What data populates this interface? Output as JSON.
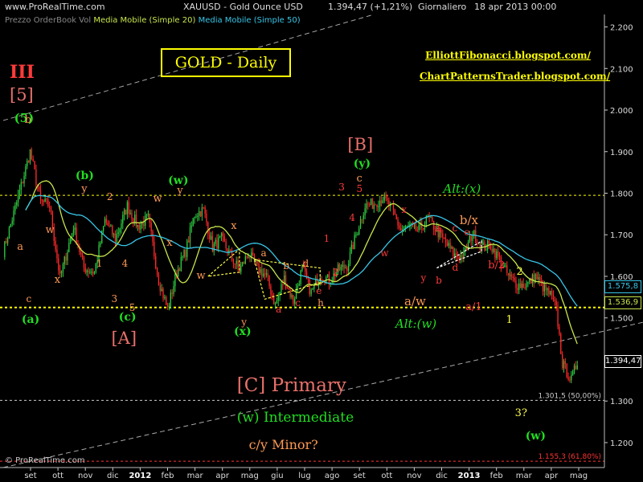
{
  "header": {
    "site": "www.ProRealTime.com",
    "instrument": "XAUUSD - Gold Ounce USD",
    "last": "1.394,47 (+1,21%)",
    "period": "Giornaliero",
    "date": "18 apr 2013 00:00"
  },
  "subheader": {
    "prefix": "Prezzo OrderBook Vol",
    "ma20": "Media Mobile (Simple 20)",
    "ma50": "Media Mobile (Simple 50)"
  },
  "colors": {
    "background": "#000000",
    "up_candle": "#2ecc40",
    "down_candle": "#ff2a2a",
    "ma20": "#c8e64b",
    "ma50": "#37c6e8",
    "level_line": "#ffff00",
    "wave_red": "#ff3b3b",
    "wave_green": "#22dd22",
    "wave_salmon": "#e8706a",
    "wave_orange": "#ff9a55",
    "wave_yellow": "#ffff44"
  },
  "title_box": "GOLD - Daily",
  "blogs": [
    "ElliottFibonacci.blogspot.com/",
    "ChartPatternsTrader.blogspot.com/"
  ],
  "copyright": "© ProRealTime.com",
  "chart_data": {
    "type": "candlestick",
    "title": "GOLD - Daily",
    "x_ticks": [
      "set",
      "ott",
      "nov",
      "dic",
      "2012",
      "feb",
      "mar",
      "apr",
      "mag",
      "giu",
      "lug",
      "ago",
      "set",
      "ott",
      "nov",
      "dic",
      "2013",
      "feb",
      "mar",
      "apr",
      "mag"
    ],
    "y_ticks": [
      1200,
      1300,
      1400,
      1500,
      1600,
      1700,
      1800,
      1900,
      2000,
      2100,
      2200
    ],
    "y_tick_labels": [
      "1.200",
      "1.300",
      "1.400",
      "1.500",
      "1.600",
      "1.700",
      "1.800",
      "1.900",
      "2.000",
      "2.100",
      "2.200"
    ],
    "ylim": [
      1140,
      2230
    ],
    "price_tags": [
      {
        "value": 1575.8,
        "label": "1.575,8",
        "color": "#37c6e8"
      },
      {
        "value": 1536.9,
        "label": "1.536,9",
        "color": "#c8e64b"
      },
      {
        "value": 1394.47,
        "label": "1.394,47",
        "color": "#ffffff"
      }
    ],
    "levels": [
      {
        "value": 1795,
        "style": "dotted",
        "color": "#ffff00"
      },
      {
        "value": 1525,
        "style": "dotted",
        "color": "#ffff00"
      },
      {
        "value": 1301.5,
        "style": "dotted",
        "color": "#cccccc",
        "label": "1.301,5 (50,00%)"
      },
      {
        "value": 1155.3,
        "style": "dotted",
        "color": "#ff3333",
        "label": "1.155,3 (61,80%)"
      }
    ],
    "trend_lines": [
      {
        "from": [
          0,
          1975
        ],
        "to": [
          248,
          2230
        ],
        "color": "#aaaaaa"
      },
      {
        "from": [
          0,
          1140
        ],
        "to": [
          600,
          1630
        ],
        "color": "#aaaaaa"
      }
    ],
    "key_points": [
      [
        0,
        1660
      ],
      [
        10,
        1790
      ],
      [
        18,
        1900
      ],
      [
        25,
        1780
      ],
      [
        31,
        1770
      ],
      [
        38,
        1595
      ],
      [
        47,
        1720
      ],
      [
        54,
        1620
      ],
      [
        61,
        1610
      ],
      [
        68,
        1735
      ],
      [
        75,
        1690
      ],
      [
        83,
        1770
      ],
      [
        90,
        1720
      ],
      [
        97,
        1740
      ],
      [
        104,
        1590
      ],
      [
        110,
        1520
      ],
      [
        116,
        1610
      ],
      [
        122,
        1660
      ],
      [
        128,
        1750
      ],
      [
        134,
        1760
      ],
      [
        140,
        1670
      ],
      [
        146,
        1690
      ],
      [
        152,
        1650
      ],
      [
        158,
        1615
      ],
      [
        164,
        1655
      ],
      [
        170,
        1620
      ],
      [
        176,
        1600
      ],
      [
        182,
        1530
      ],
      [
        188,
        1595
      ],
      [
        194,
        1540
      ],
      [
        200,
        1620
      ],
      [
        206,
        1560
      ],
      [
        212,
        1605
      ],
      [
        218,
        1590
      ],
      [
        224,
        1615
      ],
      [
        230,
        1625
      ],
      [
        236,
        1700
      ],
      [
        242,
        1770
      ],
      [
        248,
        1775
      ],
      [
        254,
        1790
      ],
      [
        260,
        1760
      ],
      [
        266,
        1710
      ],
      [
        272,
        1720
      ],
      [
        278,
        1710
      ],
      [
        284,
        1740
      ],
      [
        290,
        1710
      ],
      [
        296,
        1680
      ],
      [
        302,
        1650
      ],
      [
        308,
        1650
      ],
      [
        314,
        1705
      ],
      [
        320,
        1670
      ],
      [
        326,
        1675
      ],
      [
        332,
        1640
      ],
      [
        338,
        1600
      ],
      [
        344,
        1580
      ],
      [
        350,
        1580
      ],
      [
        356,
        1600
      ],
      [
        362,
        1570
      ],
      [
        366,
        1555
      ],
      [
        370,
        1520
      ],
      [
        374,
        1390
      ],
      [
        380,
        1350
      ],
      [
        384,
        1394
      ]
    ],
    "wave_labels": [
      {
        "text": "III",
        "x": 0,
        "y": 2090,
        "color": "wave_red",
        "size": 22,
        "bold": true
      },
      {
        "text": "[5]",
        "x": 0,
        "y": 2035,
        "color": "wave_salmon",
        "size": 21
      },
      {
        "text": "(5)",
        "x": 3,
        "y": 1980,
        "color": "wave_green",
        "size": 15,
        "bold": true
      },
      {
        "text": "b",
        "x": 10,
        "y": 1975,
        "color": "wave_orange",
        "size": 13
      },
      {
        "text": "a",
        "x": 5,
        "y": 1670,
        "color": "wave_orange",
        "size": 13
      },
      {
        "text": "c",
        "x": 11,
        "y": 1545,
        "color": "wave_orange",
        "size": 12
      },
      {
        "text": "(a)",
        "x": 8,
        "y": 1495,
        "color": "wave_green",
        "size": 14,
        "bold": true
      },
      {
        "text": "w",
        "x": 24,
        "y": 1710,
        "color": "wave_orange",
        "size": 13
      },
      {
        "text": "x",
        "x": 30,
        "y": 1590,
        "color": "wave_orange",
        "size": 13
      },
      {
        "text": "(b)",
        "x": 44,
        "y": 1840,
        "color": "wave_green",
        "size": 14,
        "bold": true
      },
      {
        "text": "y",
        "x": 48,
        "y": 1810,
        "color": "wave_orange",
        "size": 13
      },
      {
        "text": "2",
        "x": 65,
        "y": 1790,
        "color": "wave_orange",
        "size": 12
      },
      {
        "text": "1",
        "x": 58,
        "y": 1630,
        "color": "wave_orange",
        "size": 12
      },
      {
        "text": "4",
        "x": 75,
        "y": 1630,
        "color": "wave_orange",
        "size": 12
      },
      {
        "text": "3",
        "x": 68,
        "y": 1545,
        "color": "wave_orange",
        "size": 12
      },
      {
        "text": "5",
        "x": 80,
        "y": 1525,
        "color": "wave_orange",
        "size": 12
      },
      {
        "text": "(c)",
        "x": 73,
        "y": 1500,
        "color": "wave_green",
        "size": 14,
        "bold": true
      },
      {
        "text": "[A]",
        "x": 68,
        "y": 1450,
        "color": "wave_salmon",
        "size": 21
      },
      {
        "text": "w",
        "x": 96,
        "y": 1785,
        "color": "wave_orange",
        "size": 13
      },
      {
        "text": "(w)",
        "x": 106,
        "y": 1830,
        "color": "wave_green",
        "size": 14,
        "bold": true
      },
      {
        "text": "y",
        "x": 112,
        "y": 1805,
        "color": "wave_orange",
        "size": 13
      },
      {
        "text": "x",
        "x": 105,
        "y": 1680,
        "color": "wave_orange",
        "size": 13
      },
      {
        "text": "w",
        "x": 125,
        "y": 1600,
        "color": "wave_orange",
        "size": 13
      },
      {
        "text": "x",
        "x": 148,
        "y": 1720,
        "color": "wave_orange",
        "size": 13
      },
      {
        "text": "y",
        "x": 155,
        "y": 1490,
        "color": "wave_orange",
        "size": 12
      },
      {
        "text": "(x)",
        "x": 150,
        "y": 1465,
        "color": "wave_green",
        "size": 14,
        "bold": true
      },
      {
        "text": "a",
        "x": 168,
        "y": 1655,
        "color": "wave_orange",
        "size": 12
      },
      {
        "text": "b",
        "x": 183,
        "y": 1625,
        "color": "wave_orange",
        "size": 12
      },
      {
        "text": "d",
        "x": 196,
        "y": 1630,
        "color": "wave_orange",
        "size": 12
      },
      {
        "text": "a",
        "x": 178,
        "y": 1520,
        "color": "wave_red",
        "size": 12
      },
      {
        "text": "c",
        "x": 191,
        "y": 1535,
        "color": "wave_red",
        "size": 12
      },
      {
        "text": "e",
        "x": 205,
        "y": 1565,
        "color": "wave_red",
        "size": 12
      },
      {
        "text": "h",
        "x": 206,
        "y": 1535,
        "color": "wave_orange",
        "size": 12
      },
      {
        "text": "2",
        "x": 216,
        "y": 1610,
        "color": "wave_red",
        "size": 12
      },
      {
        "text": "1",
        "x": 210,
        "y": 1690,
        "color": "wave_red",
        "size": 12
      },
      {
        "text": "3",
        "x": 220,
        "y": 1815,
        "color": "wave_red",
        "size": 12
      },
      {
        "text": "4",
        "x": 227,
        "y": 1740,
        "color": "wave_red",
        "size": 12
      },
      {
        "text": "5",
        "x": 232,
        "y": 1810,
        "color": "wave_red",
        "size": 12
      },
      {
        "text": "c",
        "x": 232,
        "y": 1835,
        "color": "wave_orange",
        "size": 13
      },
      {
        "text": "(y)",
        "x": 230,
        "y": 1870,
        "color": "wave_green",
        "size": 14,
        "bold": true
      },
      {
        "text": "[B]",
        "x": 226,
        "y": 1915,
        "color": "wave_salmon",
        "size": 21
      },
      {
        "text": "w",
        "x": 248,
        "y": 1655,
        "color": "wave_red",
        "size": 12
      },
      {
        "text": "x",
        "x": 262,
        "y": 1760,
        "color": "wave_red",
        "size": 12
      },
      {
        "text": "a",
        "x": 285,
        "y": 1715,
        "color": "wave_red",
        "size": 12
      },
      {
        "text": "c",
        "x": 296,
        "y": 1715,
        "color": "wave_red",
        "size": 12
      },
      {
        "text": "e",
        "x": 304,
        "y": 1705,
        "color": "wave_red",
        "size": 12
      },
      {
        "text": "b/x",
        "x": 301,
        "y": 1735,
        "color": "wave_orange",
        "size": 15
      },
      {
        "text": "y",
        "x": 275,
        "y": 1595,
        "color": "wave_red",
        "size": 12
      },
      {
        "text": "b",
        "x": 285,
        "y": 1590,
        "color": "wave_red",
        "size": 12
      },
      {
        "text": "d",
        "x": 296,
        "y": 1620,
        "color": "wave_red",
        "size": 12
      },
      {
        "text": "a/w",
        "x": 264,
        "y": 1540,
        "color": "wave_orange",
        "size": 15
      },
      {
        "text": "a/1",
        "x": 305,
        "y": 1525,
        "color": "wave_red",
        "size": 13
      },
      {
        "text": "b/2",
        "x": 320,
        "y": 1625,
        "color": "wave_red",
        "size": 13
      },
      {
        "text": "2",
        "x": 339,
        "y": 1610,
        "color": "wave_yellow",
        "size": 13
      },
      {
        "text": "1",
        "x": 332,
        "y": 1495,
        "color": "wave_yellow",
        "size": 13
      },
      {
        "text": "3?",
        "x": 338,
        "y": 1270,
        "color": "wave_yellow",
        "size": 13
      },
      {
        "text": "(w)",
        "x": 345,
        "y": 1215,
        "color": "wave_green",
        "size": 14,
        "bold": true
      },
      {
        "text": "Alt:(x)",
        "x": 290,
        "y": 1810,
        "color": "wave_green",
        "size": 15,
        "italic": true
      },
      {
        "text": "Alt:(w)",
        "x": 258,
        "y": 1485,
        "color": "wave_green",
        "size": 15,
        "italic": true
      },
      {
        "text": "[C] Primary",
        "x": 152,
        "y": 1335,
        "color": "wave_salmon",
        "size": 23
      },
      {
        "text": "(w)  Intermediate",
        "x": 152,
        "y": 1260,
        "color": "wave_green",
        "size": 17
      },
      {
        "text": "c/y    Minor?",
        "x": 160,
        "y": 1195,
        "color": "wave_orange",
        "size": 16
      }
    ]
  }
}
